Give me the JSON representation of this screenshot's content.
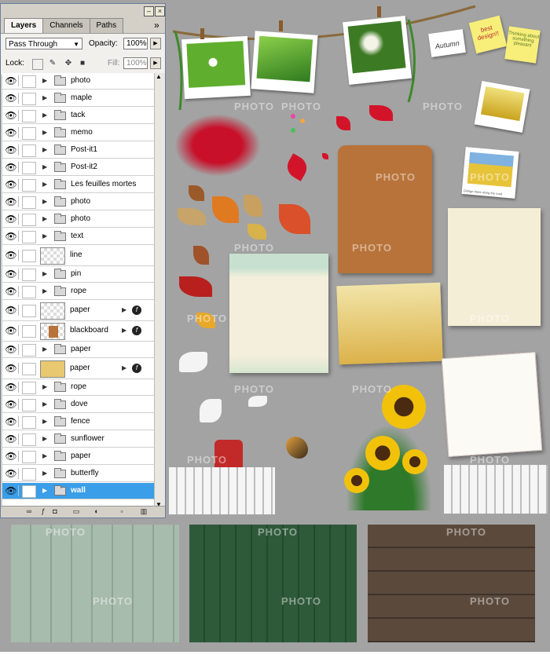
{
  "panel": {
    "tabs": [
      "Layers",
      "Channels",
      "Paths"
    ],
    "blend_mode": "Pass Through",
    "opacity_label": "Opacity:",
    "opacity_value": "100%",
    "lock_label": "Lock:",
    "fill_label": "Fill:",
    "fill_value": "100%",
    "menu_glyph": "»",
    "layers": [
      {
        "name": "photo",
        "type": "folder"
      },
      {
        "name": "maple",
        "type": "folder"
      },
      {
        "name": "tack",
        "type": "folder"
      },
      {
        "name": "memo",
        "type": "folder"
      },
      {
        "name": "Post-it1",
        "type": "folder"
      },
      {
        "name": "Post-it2",
        "type": "folder"
      },
      {
        "name": "Les feuilles mortes",
        "type": "folder"
      },
      {
        "name": "photo",
        "type": "folder"
      },
      {
        "name": "photo",
        "type": "folder"
      },
      {
        "name": "text",
        "type": "folder"
      },
      {
        "name": "line",
        "type": "layer"
      },
      {
        "name": "pin",
        "type": "folder"
      },
      {
        "name": "rope",
        "type": "folder"
      },
      {
        "name": "paper",
        "type": "layer",
        "fx": true
      },
      {
        "name": "blackboard",
        "type": "layer",
        "fx": true
      },
      {
        "name": "paper",
        "type": "folder"
      },
      {
        "name": "paper",
        "type": "layer",
        "fx": true
      },
      {
        "name": "rope",
        "type": "folder"
      },
      {
        "name": "dove",
        "type": "folder"
      },
      {
        "name": "fence",
        "type": "folder"
      },
      {
        "name": "sunflower",
        "type": "folder"
      },
      {
        "name": "paper",
        "type": "folder"
      },
      {
        "name": "butterfly",
        "type": "folder"
      },
      {
        "name": "wall",
        "type": "folder",
        "selected": true
      }
    ]
  },
  "canvas": {
    "watermark": "PHOTO",
    "notes": {
      "autumn": "Autumn",
      "best": "best design!!",
      "thinking": "Thinking about something pleasant"
    },
    "photo_caption": "Ginkgo trees along the road"
  },
  "colors": {
    "canvas_bg": "#a3a3a3",
    "panel_bg": "#d4d0c8",
    "selection": "#3a9ee8",
    "wood_green_light": "#9fb3a6",
    "wood_green_dark": "#2f5a3a",
    "wood_brown": "#5b4a3c"
  }
}
